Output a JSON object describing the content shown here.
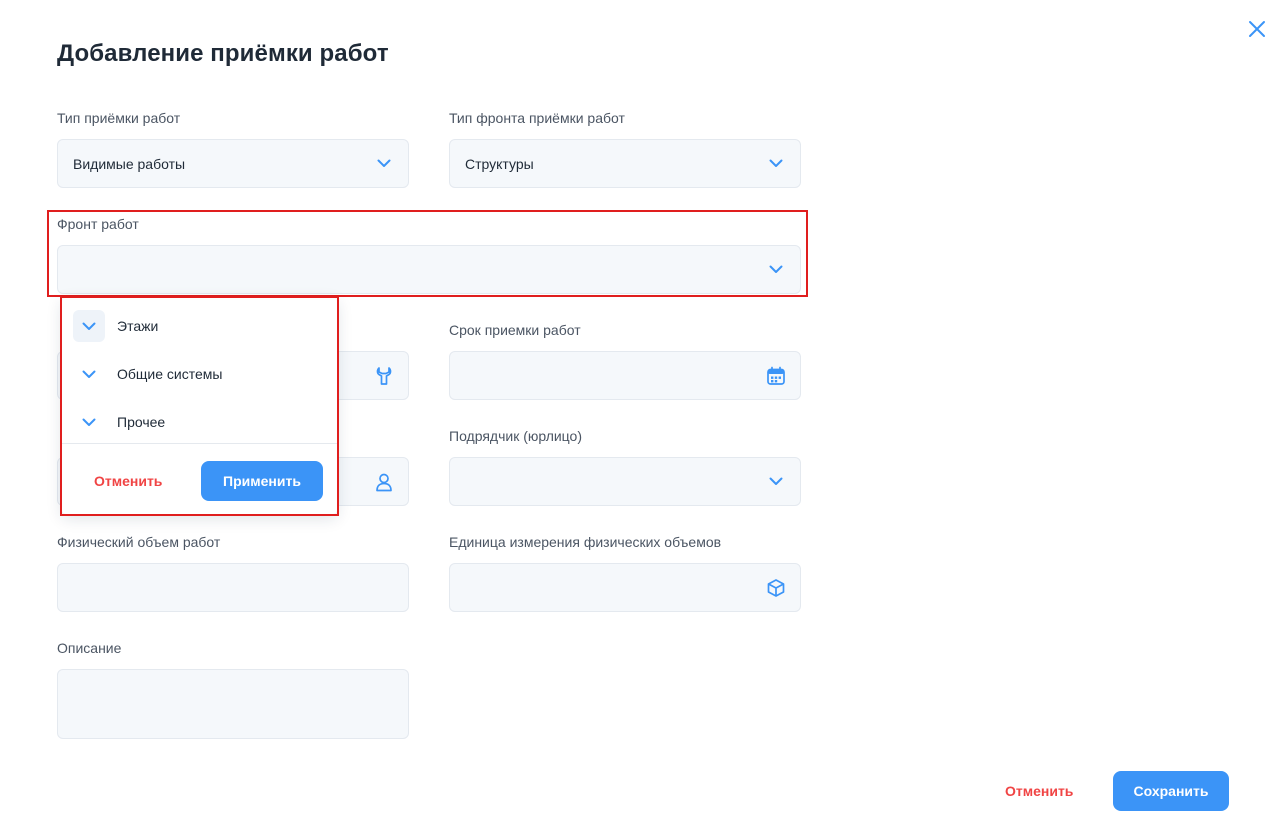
{
  "dialog": {
    "title": "Добавление приёмки работ",
    "close_icon": "close-icon"
  },
  "fields": {
    "work_type": {
      "label": "Тип приёмки работ",
      "value": "Видимые работы",
      "icon": "chevron-down-icon"
    },
    "front_type": {
      "label": "Тип фронта приёмки работ",
      "value": "Структуры",
      "icon": "chevron-down-icon"
    },
    "front": {
      "label": "Фронт работ",
      "value": "",
      "icon": "chevron-down-icon"
    },
    "tool_field": {
      "value": "",
      "icon": "wrench-icon"
    },
    "deadline": {
      "label": "Срок приемки работ",
      "value": "",
      "icon": "calendar-icon"
    },
    "person_field": {
      "value": "",
      "icon": "person-icon"
    },
    "contractor": {
      "label": "Подрядчик (юрлицо)",
      "value": "",
      "icon": "chevron-down-icon"
    },
    "physical_volume": {
      "label": "Физический объем работ",
      "value": ""
    },
    "unit": {
      "label": "Единица измерения физических объемов",
      "value": "",
      "icon": "cube-icon"
    },
    "description": {
      "label": "Описание",
      "value": ""
    }
  },
  "dropdown": {
    "items": [
      {
        "label": "Этажи"
      },
      {
        "label": "Общие системы"
      },
      {
        "label": "Прочее"
      }
    ],
    "cancel_label": "Отменить",
    "apply_label": "Применить"
  },
  "footer": {
    "cancel_label": "Отменить",
    "save_label": "Сохранить"
  },
  "colors": {
    "accent": "#3b94f7",
    "danger": "#f04444",
    "highlight": "#e01e1e",
    "field_bg": "#f5f8fb"
  }
}
